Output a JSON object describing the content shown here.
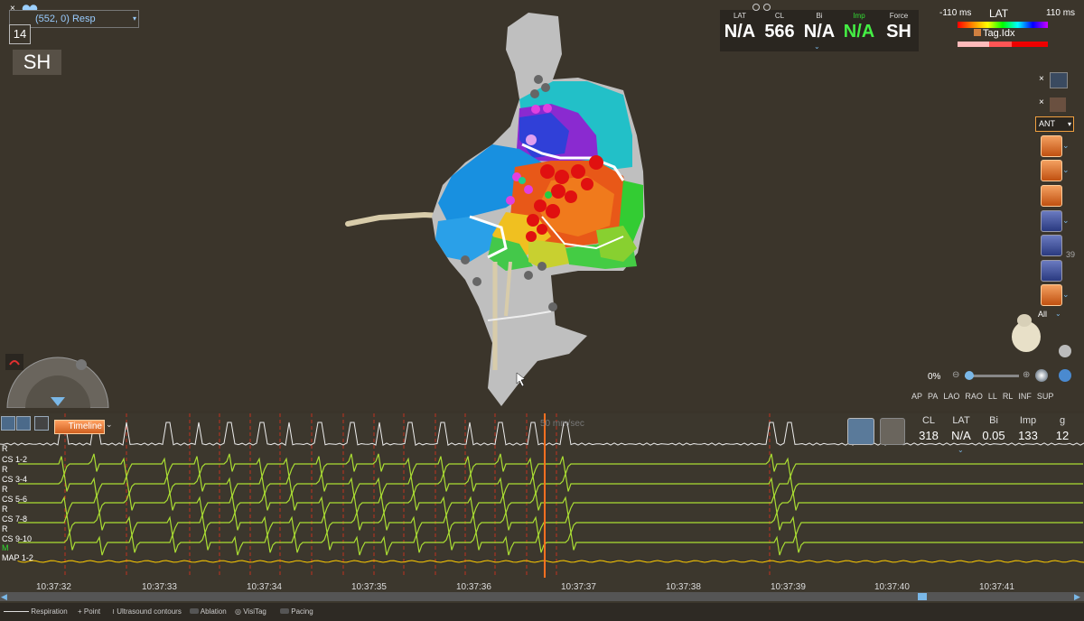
{
  "map": {
    "id_text": "(552, 0) Resp",
    "counter": "14",
    "label_sh": "SH"
  },
  "stats": {
    "items": [
      {
        "label": "LAT",
        "value": "N/A",
        "label_color": "#ffffff",
        "value_color": "#ffffff"
      },
      {
        "label": "CL",
        "value": "566",
        "label_color": "#ffffff",
        "value_color": "#ffffff"
      },
      {
        "label": "Bi",
        "value": "N/A",
        "label_color": "#ffffff",
        "value_color": "#ffffff"
      },
      {
        "label": "Imp",
        "value": "N/A",
        "label_color": "#33dd33",
        "value_color": "#44ee44"
      },
      {
        "label": "Force",
        "value": "SH",
        "label_color": "#ffffff",
        "value_color": "#ffffff"
      }
    ]
  },
  "lat_legend": {
    "min": "-110 ms",
    "title": "LAT",
    "max": "110 ms",
    "tag_label": "Tag.Idx"
  },
  "side_panel": {
    "view_select": "ANT",
    "filter": "All",
    "side_value": "39"
  },
  "zoom": {
    "percent": "0%",
    "views": [
      "AP",
      "PA",
      "LAO",
      "RAO",
      "LL",
      "RL",
      "INF",
      "SUP"
    ]
  },
  "strip": {
    "timeline_label": "Timeline",
    "speed": "50 mm/sec",
    "stats": [
      {
        "label": "CL",
        "value": "318"
      },
      {
        "label": "LAT",
        "value": "N/A"
      },
      {
        "label": "Bi",
        "value": "0.05"
      },
      {
        "label": "Imp",
        "value": "133"
      },
      {
        "label": "g",
        "value": "12"
      }
    ],
    "channels": [
      {
        "prefix": "R",
        "name": "CS 1-2"
      },
      {
        "prefix": "R",
        "name": "CS 3-4"
      },
      {
        "prefix": "R",
        "name": "CS 5-6"
      },
      {
        "prefix": "R",
        "name": "CS 7-8"
      },
      {
        "prefix": "R",
        "name": "CS 9-10"
      },
      {
        "prefix": "M",
        "name": "MAP 1-2"
      }
    ],
    "times": [
      "10:37:32",
      "10:37:33",
      "10:37:34",
      "10:37:35",
      "10:37:36",
      "10:37:37",
      "10:37:38",
      "10:37:39",
      "10:37:40",
      "10:37:41"
    ]
  },
  "legend": {
    "items": [
      "Respiration",
      "Point",
      "Ultrasound contours",
      "Ablation",
      "VisiTag",
      "Pacing"
    ]
  },
  "colors": {
    "accent": "#f08030",
    "ecg": "#aadd33",
    "marker": "#ffcc00",
    "cursor": "#ff7020"
  }
}
